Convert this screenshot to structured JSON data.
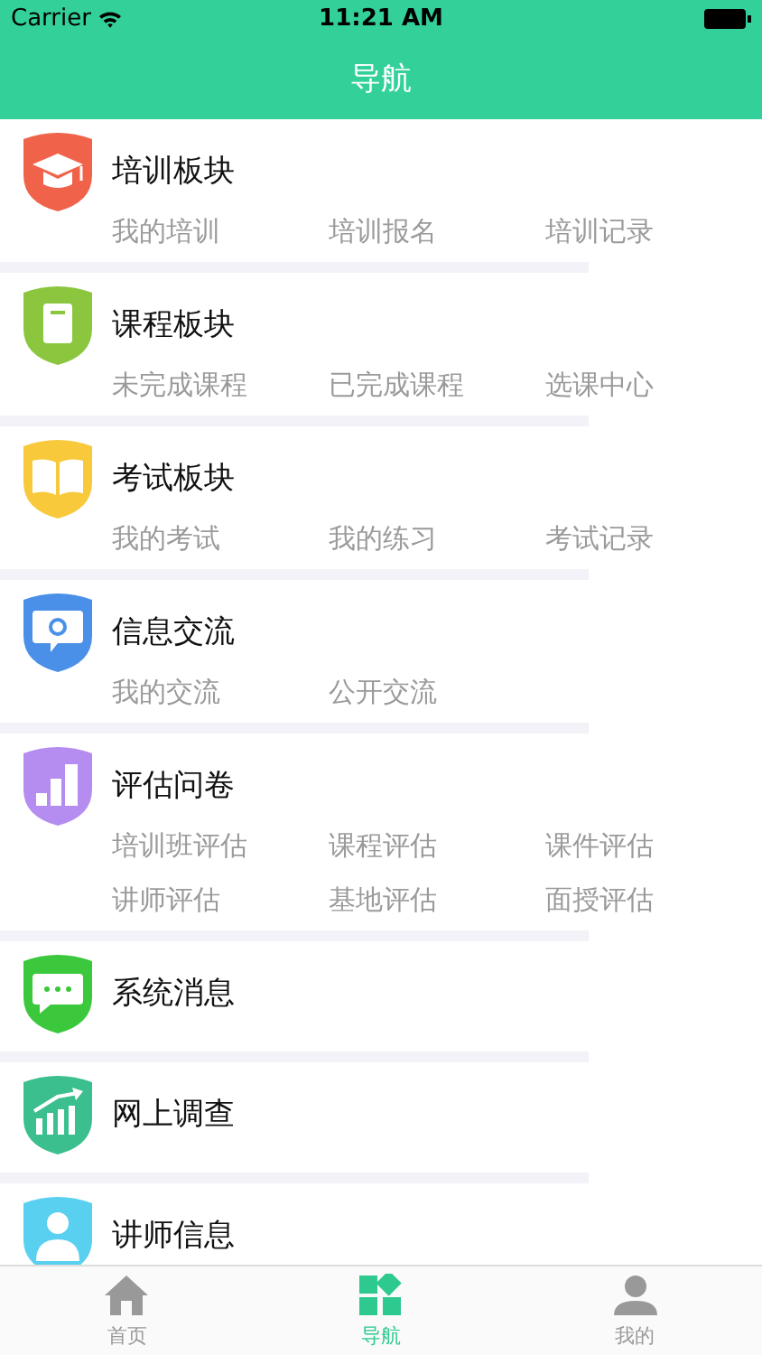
{
  "status_bar": {
    "carrier": "Carrier",
    "time": "11:21 AM"
  },
  "nav_bar": {
    "title": "导航"
  },
  "sections": [
    {
      "title": "培训板块",
      "color": "#f0634a",
      "links": [
        "我的培训",
        "培训报名",
        "培训记录"
      ]
    },
    {
      "title": "课程板块",
      "color": "#8cc63f",
      "links": [
        "未完成课程",
        "已完成课程",
        "选课中心"
      ]
    },
    {
      "title": "考试板块",
      "color": "#f9c93c",
      "links": [
        "我的考试",
        "我的练习",
        "考试记录"
      ]
    },
    {
      "title": "信息交流",
      "color": "#4a90e8",
      "links": [
        "我的交流",
        "公开交流"
      ]
    },
    {
      "title": "评估问卷",
      "color": "#b58cf0",
      "links": [
        "培训班评估",
        "课程评估",
        "课件评估",
        "讲师评估",
        "基地评估",
        "面授评估"
      ]
    },
    {
      "title": "系统消息",
      "color": "#3cc83c"
    },
    {
      "title": "网上调查",
      "color": "#3cbf8f"
    },
    {
      "title": "讲师信息",
      "color": "#5ad0f0"
    }
  ],
  "tab_bar": [
    {
      "label": "首页",
      "selected": false
    },
    {
      "label": "导航",
      "selected": true
    },
    {
      "label": "我的",
      "selected": false
    }
  ]
}
